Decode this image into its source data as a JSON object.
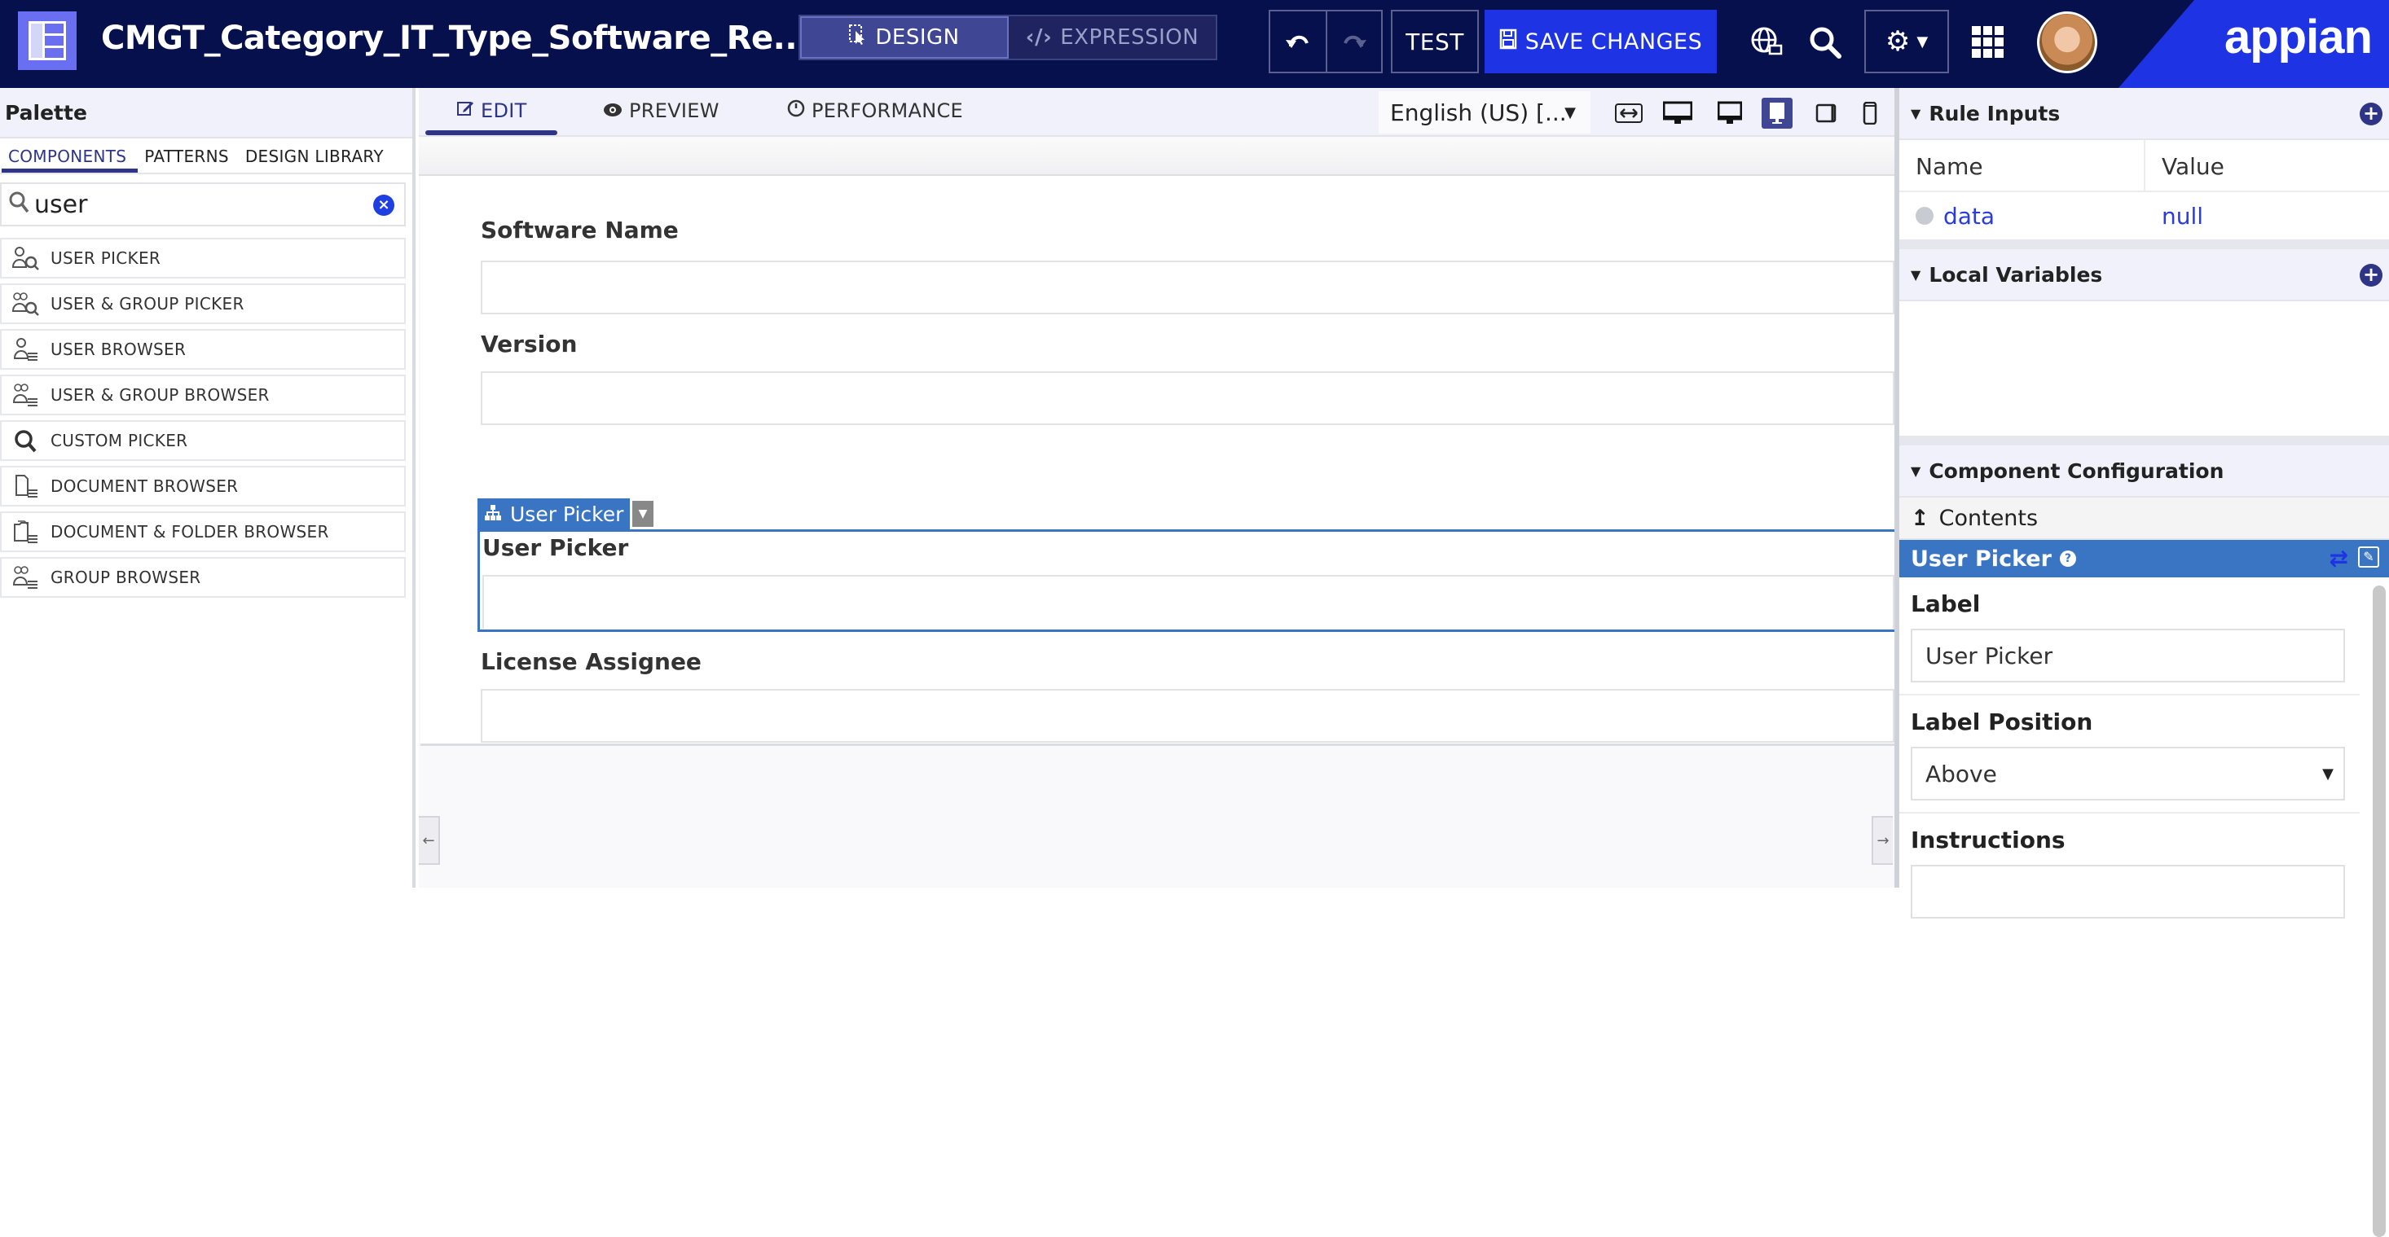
{
  "header": {
    "app_icon": "interface-icon",
    "title": "CMGT_Category_IT_Type_Software_Re...",
    "modes": [
      {
        "label": "DESIGN",
        "icon": "design-cursor-icon",
        "active": true
      },
      {
        "label": "EXPRESSION",
        "icon": "code-icon",
        "active": false
      }
    ],
    "undo_icon": "undo-icon",
    "redo_icon": "redo-icon",
    "test_label": "TEST",
    "save_label": "SAVE CHANGES",
    "save_icon": "floppy-disk-icon",
    "brand": "appian",
    "colors": {
      "header_bg": "#06104c",
      "save_bg": "#1d33e4",
      "brand_bg": "#1d33e4",
      "active_mode_bg": "#3f4795"
    }
  },
  "palette": {
    "title": "Palette",
    "tabs": [
      {
        "label": "COMPONENTS",
        "active": true
      },
      {
        "label": "PATTERNS",
        "active": false
      },
      {
        "label": "DESIGN LIBRARY",
        "active": false
      }
    ],
    "search": {
      "value": "user",
      "placeholder": ""
    },
    "items": [
      {
        "label": "USER PICKER",
        "icon": "user-search-icon"
      },
      {
        "label": "USER & GROUP PICKER",
        "icon": "group-search-icon"
      },
      {
        "label": "USER BROWSER",
        "icon": "user-list-icon"
      },
      {
        "label": "USER & GROUP BROWSER",
        "icon": "group-list-icon"
      },
      {
        "label": "CUSTOM PICKER",
        "icon": "search-icon"
      },
      {
        "label": "DOCUMENT BROWSER",
        "icon": "document-list-icon"
      },
      {
        "label": "DOCUMENT & FOLDER BROWSER",
        "icon": "folder-list-icon"
      },
      {
        "label": "GROUP BROWSER",
        "icon": "group-list-icon"
      }
    ]
  },
  "canvas": {
    "tabs": [
      {
        "label": "EDIT",
        "active": true
      },
      {
        "label": "PREVIEW",
        "active": false
      },
      {
        "label": "PERFORMANCE",
        "active": false
      }
    ],
    "locale": "English (US) [...",
    "device_modes": [
      "fit-width",
      "desktop-wide",
      "desktop",
      "tablet-landscape",
      "tablet-portrait",
      "phone"
    ],
    "active_device": "tablet-landscape",
    "fields": [
      {
        "label": "Software Name",
        "value": ""
      },
      {
        "label": "Version",
        "value": ""
      },
      {
        "label": "User Picker",
        "value": "",
        "selected": true
      },
      {
        "label": "License Assignee",
        "value": ""
      }
    ],
    "selection_tag": "User Picker",
    "selection_color": "#3a75c4"
  },
  "right_panel": {
    "rule_inputs": {
      "title": "Rule Inputs",
      "columns": [
        "Name",
        "Value"
      ],
      "rows": [
        {
          "name": "data",
          "value": "null"
        }
      ]
    },
    "local_variables": {
      "title": "Local Variables"
    },
    "component_config": {
      "title": "Component Configuration",
      "contents_label": "Contents",
      "component_name": "User Picker",
      "fields": [
        {
          "label": "Label",
          "value": "User Picker",
          "type": "text"
        },
        {
          "label": "Label Position",
          "value": "Above",
          "type": "select"
        },
        {
          "label": "Instructions",
          "value": "",
          "type": "text"
        }
      ]
    }
  }
}
